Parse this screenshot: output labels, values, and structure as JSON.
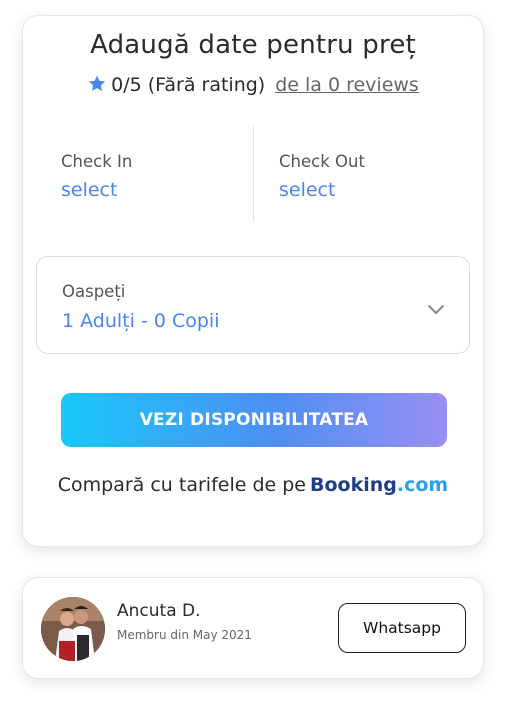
{
  "booking_card": {
    "title": "Adaugă date pentru preț",
    "rating": "0/5 (Fără rating)",
    "reviews_link": "de la 0 reviews",
    "check_in": {
      "label": "Check In",
      "value": "select"
    },
    "check_out": {
      "label": "Check Out",
      "value": "select"
    },
    "guests": {
      "label": "Oaspeți",
      "value": "1 Adulți - 0 Copii"
    },
    "cta_label": "VEZI DISPONIBILITATEA",
    "compare_text": "Compară cu tarifele de pe",
    "booking_logo": {
      "part1": "Booking",
      "part2": ".com"
    },
    "accent_color": "#4a86f0",
    "star_color": "#4a86f0"
  },
  "host": {
    "name": "Ancuta D.",
    "member_since": "Membru din May 2021",
    "whatsapp_label": "Whatsapp"
  }
}
